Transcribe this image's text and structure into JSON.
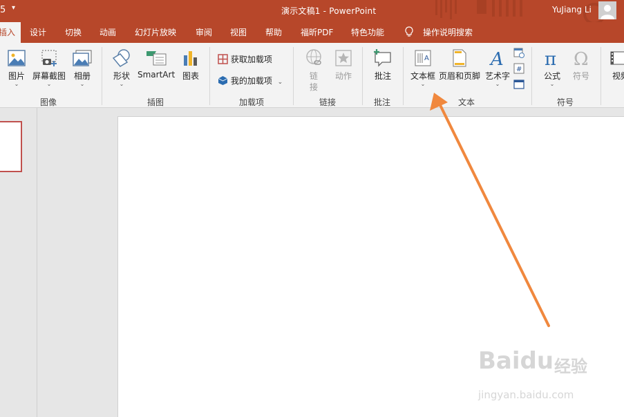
{
  "titlebar": {
    "qa_num": "5",
    "qa_dropdown": "▾",
    "title": "演示文稿1  -  PowerPoint",
    "user": "YuJiang Li"
  },
  "tabs": [
    {
      "label": "插入",
      "active": true
    },
    {
      "label": "设计"
    },
    {
      "label": "切换"
    },
    {
      "label": "动画"
    },
    {
      "label": "幻灯片放映"
    },
    {
      "label": "审阅"
    },
    {
      "label": "视图"
    },
    {
      "label": "帮助"
    },
    {
      "label": "福昕PDF"
    },
    {
      "label": "特色功能"
    },
    {
      "label": "操作说明搜索"
    }
  ],
  "ribbon": {
    "groups": {
      "images": "图像",
      "illustrations": "插图",
      "addins": "加载项",
      "links": "链接",
      "comments": "批注",
      "text": "文本",
      "symbols": "符号"
    },
    "buttons": {
      "picture": "图片",
      "screenshot": "屏幕截图",
      "album": "相册",
      "shapes": "形状",
      "smartart": "SmartArt",
      "chart": "图表",
      "get_addins": "获取加载项",
      "my_addins": "我的加载项",
      "link": "链\n接",
      "link_a": "链",
      "link_b": "接",
      "action": "动作",
      "comment": "批注",
      "textbox": "文本框",
      "header_footer": "页眉和页脚",
      "wordart": "艺术字",
      "equation": "公式",
      "symbol": "符号",
      "video": "视频"
    },
    "chevron": "⌄"
  },
  "watermark": {
    "brand": "Baidu",
    "brand_cn": "经验",
    "url": "jingyan.baidu.com"
  },
  "colors": {
    "accent": "#b7472a",
    "arrow": "#f0883e",
    "ribbon_bg": "#f3f3f3"
  }
}
